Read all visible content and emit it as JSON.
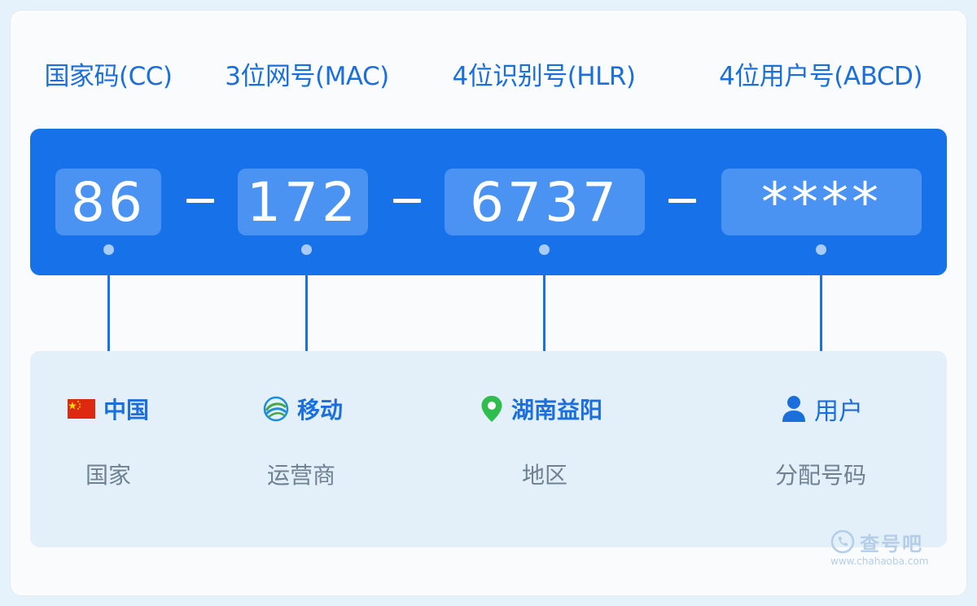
{
  "headers": [
    {
      "label": "国家码(CC)"
    },
    {
      "label": "3位网号(MAC)"
    },
    {
      "label": "4位识别号(HLR)"
    },
    {
      "label": "4位用户号(ABCD)"
    }
  ],
  "segments": [
    {
      "value": "86"
    },
    {
      "value": "172"
    },
    {
      "value": "6737"
    },
    {
      "value": "****"
    }
  ],
  "info": [
    {
      "title": "中国",
      "subtitle": "国家",
      "icon": "china-flag-icon"
    },
    {
      "title": "移动",
      "subtitle": "运营商",
      "icon": "china-mobile-logo-icon"
    },
    {
      "title": "湖南益阳",
      "subtitle": "地区",
      "icon": "location-pin-icon"
    },
    {
      "title": "用户",
      "subtitle": "分配号码",
      "icon": "user-icon"
    }
  ],
  "watermark": {
    "brand": "查号吧",
    "url": "www.chahaoba.com"
  },
  "colors": {
    "accent": "#1771e8",
    "segment_bg": "#4a93f2",
    "card_bg": "#e3eff9",
    "pin_green": "#2fbd4e",
    "flag_red": "#de2910"
  }
}
